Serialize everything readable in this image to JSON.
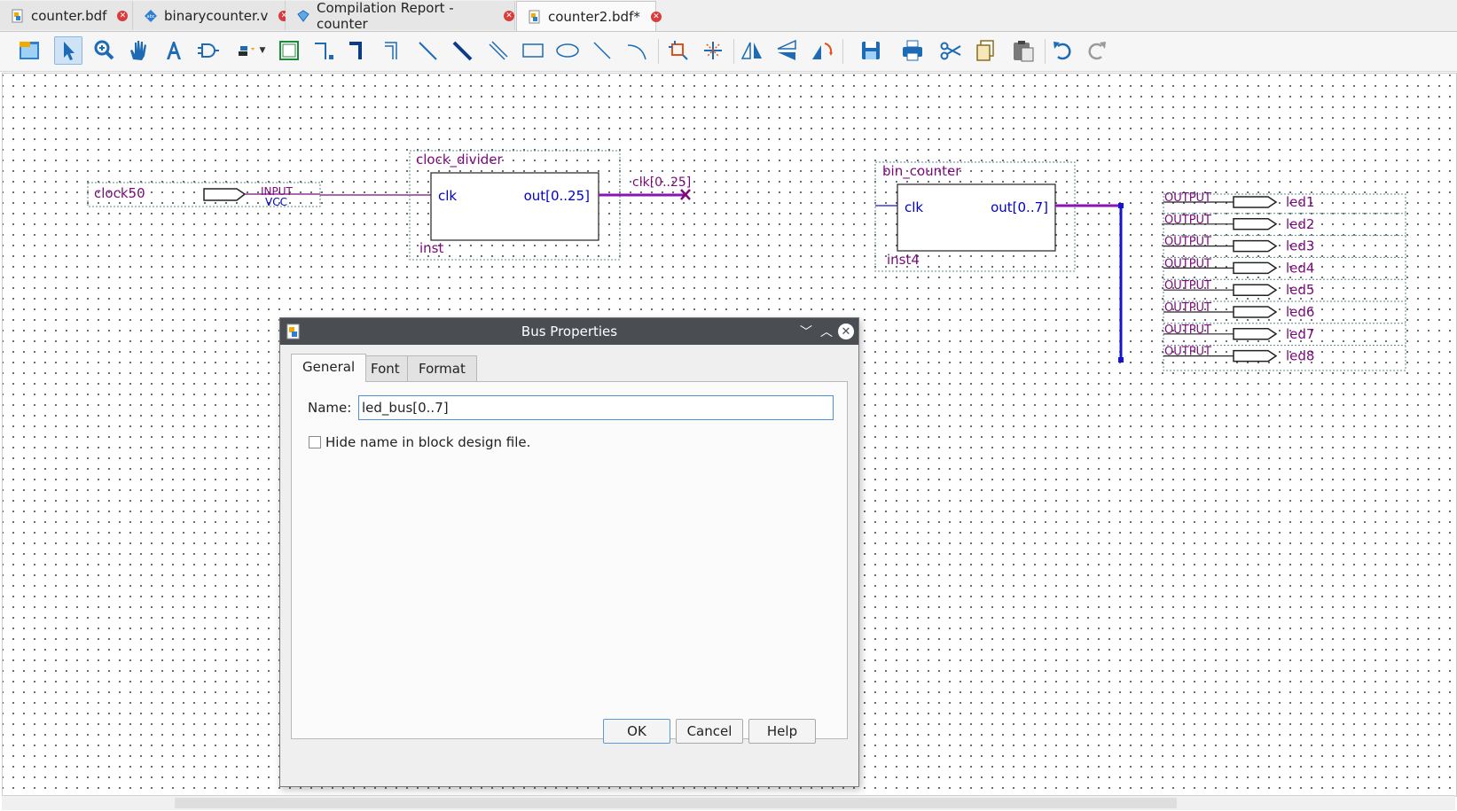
{
  "tabs": [
    {
      "label": "counter.bdf",
      "icon": "bdf-file-icon",
      "active": false
    },
    {
      "label": "binarycounter.v",
      "icon": "verilog-file-icon",
      "active": false
    },
    {
      "label": "Compilation Report - counter",
      "icon": "compilation-report-icon",
      "active": false
    },
    {
      "label": "counter2.bdf*",
      "icon": "bdf-file-icon",
      "active": true
    }
  ],
  "toolbar": {
    "tools": [
      "detach-window-icon",
      "selection-tool-icon",
      "zoom-tool-icon",
      "hand-tool-icon",
      "text-tool-icon",
      "symbol-tool-icon",
      "pin-tool-icon",
      "block-tool-icon",
      "orthogonal-node-tool-icon",
      "orthogonal-bus-tool-icon",
      "orthogonal-conduit-tool-icon",
      "diagonal-node-tool-icon",
      "diagonal-bus-tool-icon",
      "diagonal-conduit-tool-icon",
      "rectangle-tool-icon",
      "oval-tool-icon",
      "line-tool-icon",
      "arc-tool-icon",
      "rubberbanding-icon",
      "partial-line-selection-icon",
      "flip-horizontal-icon",
      "flip-vertical-icon",
      "rotate-icon",
      "save-icon",
      "print-icon",
      "cut-icon",
      "copy-icon",
      "paste-icon",
      "undo-icon",
      "redo-icon"
    ]
  },
  "schematic": {
    "input_pin": {
      "name": "clock50",
      "type": "INPUT",
      "default": "VCC"
    },
    "clock_divider": {
      "title": "clock_divider",
      "port_in": "clk",
      "port_out": "out[0..25]",
      "instance": "inst",
      "bus_label": "clk[0..25]"
    },
    "bin_counter": {
      "title": "bin_counter",
      "port_in": "clk",
      "port_out": "out[0..7]",
      "instance": "inst4"
    },
    "outputs": [
      {
        "type": "OUTPUT",
        "name": "led1"
      },
      {
        "type": "OUTPUT",
        "name": "led2"
      },
      {
        "type": "OUTPUT",
        "name": "led3"
      },
      {
        "type": "OUTPUT",
        "name": "led4"
      },
      {
        "type": "OUTPUT",
        "name": "led5"
      },
      {
        "type": "OUTPUT",
        "name": "led6"
      },
      {
        "type": "OUTPUT",
        "name": "led7"
      },
      {
        "type": "OUTPUT",
        "name": "led8"
      }
    ]
  },
  "colors": {
    "schematic_label": "#7a0a7a",
    "port_text": "#0000c8",
    "bus": "#8a14b4",
    "bus_line": "#1414d2"
  },
  "dialog": {
    "title": "Bus Properties",
    "tabs": [
      "General",
      "Font",
      "Format"
    ],
    "active_tab": "General",
    "name_label": "Name:",
    "name_value": "led_bus[0..7]",
    "hide_label": "Hide name in block design file.",
    "hide_checked": false,
    "ok_label": "OK",
    "cancel_label": "Cancel",
    "help_label": "Help"
  }
}
